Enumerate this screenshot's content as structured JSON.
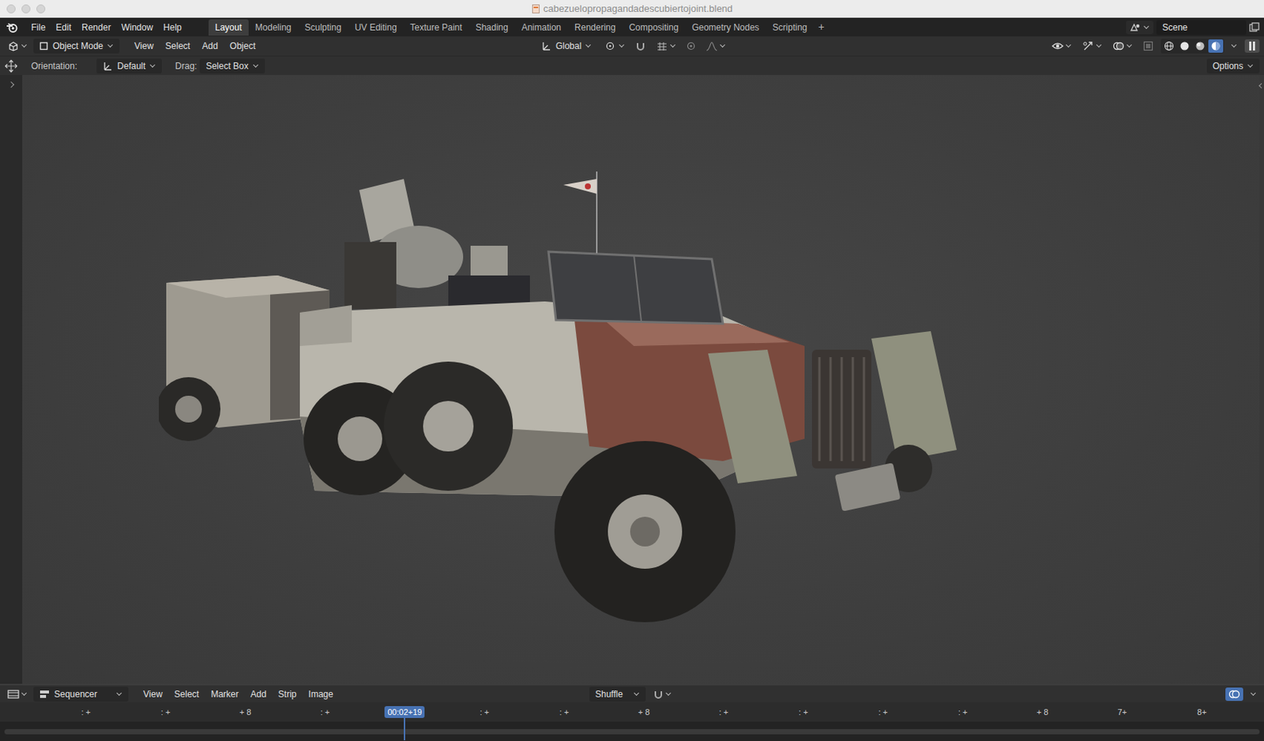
{
  "window": {
    "title": "cabezuelopropagandadescubiertojoint.blend"
  },
  "menu": [
    "File",
    "Edit",
    "Render",
    "Window",
    "Help"
  ],
  "workspaces": [
    {
      "label": "Layout",
      "selected": true
    },
    {
      "label": "Modeling",
      "selected": false
    },
    {
      "label": "Sculpting",
      "selected": false
    },
    {
      "label": "UV Editing",
      "selected": false
    },
    {
      "label": "Texture Paint",
      "selected": false
    },
    {
      "label": "Shading",
      "selected": false
    },
    {
      "label": "Animation",
      "selected": false
    },
    {
      "label": "Rendering",
      "selected": false
    },
    {
      "label": "Compositing",
      "selected": false
    },
    {
      "label": "Geometry Nodes",
      "selected": false
    },
    {
      "label": "Scripting",
      "selected": false
    }
  ],
  "add_workspace": "+",
  "scene": "Scene",
  "viewport_header": {
    "mode": "Object Mode",
    "menus": [
      "View",
      "Select",
      "Add",
      "Object"
    ],
    "orientation": "Global"
  },
  "shading_modes": [
    {
      "kind": "wireframe",
      "selected": false
    },
    {
      "kind": "solid",
      "selected": false
    },
    {
      "kind": "material",
      "selected": false
    },
    {
      "kind": "rendered",
      "selected": true
    }
  ],
  "tool_settings": {
    "orientation_label": "Orientation:",
    "orientation": "Default",
    "drag_label": "Drag:",
    "drag": "Select Box",
    "options": "Options"
  },
  "sequencer": {
    "editor": "Sequencer",
    "menus": [
      "View",
      "Select",
      "Marker",
      "Add",
      "Strip",
      "Image"
    ],
    "sort": "Shuffle",
    "ruler": [
      {
        "kind": "tick",
        "label": ": +"
      },
      {
        "kind": "tick",
        "label": ": +"
      },
      {
        "kind": "tick",
        "label": "+ 8"
      },
      {
        "kind": "tick",
        "label": ": +"
      },
      {
        "kind": "playhead",
        "label": "00:02+19"
      },
      {
        "kind": "tick",
        "label": ": +"
      },
      {
        "kind": "tick",
        "label": ": +"
      },
      {
        "kind": "tick",
        "label": "+ 8"
      },
      {
        "kind": "tick",
        "label": ": +"
      },
      {
        "kind": "tick",
        "label": ": +"
      },
      {
        "kind": "tick",
        "label": ": +"
      },
      {
        "kind": "tick",
        "label": ": +"
      },
      {
        "kind": "tick",
        "label": "+ 8"
      },
      {
        "kind": "tick",
        "label": "7+"
      },
      {
        "kind": "tick",
        "label": "8+"
      }
    ]
  }
}
